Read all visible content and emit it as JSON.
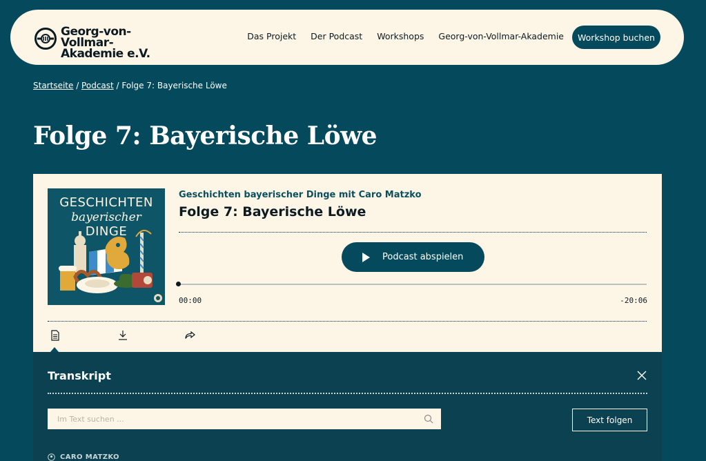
{
  "header": {
    "logo_line1": "Georg-von-Vollmar-",
    "logo_line2": "Akademie e.V.",
    "nav": [
      "Das Projekt",
      "Der Podcast",
      "Workshops",
      "Georg-von-Vollmar-Akademie"
    ],
    "cta_label": "Workshop buchen"
  },
  "breadcrumb": {
    "home": "Startseite",
    "sep1": " / ",
    "podcast": "Podcast",
    "sep2": " / ",
    "current": "Folge 7: Bayerische Löwe"
  },
  "page_title": "Folge 7: Bayerische Löwe",
  "player": {
    "cover_line1": "GESCHICHTEN",
    "cover_line2": "bayerischer",
    "cover_line3": "DINGE",
    "series": "Geschichten bayerischer Dinge mit Caro Matzko",
    "episode": "Folge 7: Bayerische Löwe",
    "play_label": "Podcast abspielen",
    "time_current": "00:00",
    "time_remaining": "-20:06",
    "progress": 0,
    "tools": [
      "transcript-icon",
      "download-icon",
      "share-icon"
    ]
  },
  "transcript": {
    "title": "Transkript",
    "search_placeholder": "Im Text suchen ...",
    "follow_label": "Text folgen",
    "speaker": "CARO MATZKO"
  },
  "colors": {
    "background": "#044a5c",
    "cream": "#fdf5e6",
    "panel": "#0b4150",
    "ink": "#0c1b22"
  }
}
